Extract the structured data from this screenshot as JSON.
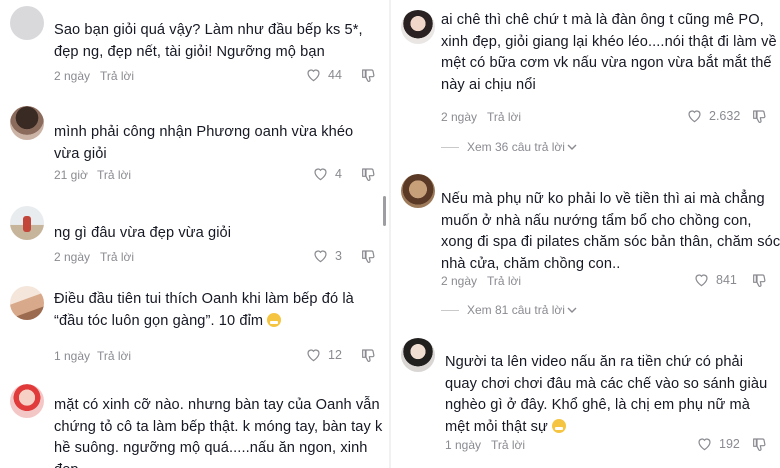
{
  "left": {
    "comments": [
      {
        "text": "Sao bạn giỏi quá vậy? Làm như đầu bếp ks 5*, đẹp ng, đẹp nết, tài giỏi! Ngưỡng mộ bạn",
        "time": "2 ngày",
        "reply": "Trả lời",
        "likes": "44"
      },
      {
        "text": "mình phải công nhận Phương oanh vừa khéo vừa giỏi",
        "time": "21 giờ",
        "reply": "Trả lời",
        "likes": "4"
      },
      {
        "text": "ng gì đâu vừa đẹp vừa giỏi",
        "time": "2 ngày",
        "reply": "Trả lời",
        "likes": "3"
      },
      {
        "text": "Điều đầu tiên tui thích Oanh khi làm bếp đó là “đầu tóc luôn gọn gàng”. 10 đỉm",
        "time": "1 ngày",
        "reply": "Trả lời",
        "likes": "12"
      },
      {
        "text": "mặt có xinh cỡ nào. nhưng bàn tay của Oanh vẫn chứng tỏ cô ta làm bếp thật. k móng tay, bàn tay k hề suông. ngưỡng mộ quá.....nấu ăn ngon, xinh đẹp"
      }
    ]
  },
  "right": {
    "comments": [
      {
        "text": "ai chê thì chê chứ t mà là đàn ông t cũng mê PO, xinh đẹp, giỏi giang lại khéo léo....nói thật đi làm về mệt có bữa cơm vk nấu vừa ngon vừa bắt mắt thế này ai chịu nổi",
        "time": "2 ngày",
        "reply": "Trả lời",
        "likes": "2.632",
        "more": "Xem 36 câu trả lời"
      },
      {
        "text": "Nếu mà phụ nữ ko phải lo về tiền thì ai mà chẳng muốn ở nhà nấu nướng tẩm bổ cho chồng con, xong đi spa đi pilates chăm sóc bản thân, chăm sóc nhà cửa, chăm chồng con..",
        "time": "2 ngày",
        "reply": "Trả lời",
        "likes": "841",
        "more": "Xem 81 câu trả lời"
      },
      {
        "text": "Người ta lên video nấu ăn ra tiền chứ có phải quay chơi chơi đâu mà các chế vào so sánh giàu nghèo gì ở đây. Khổ ghê, là chị em phụ nữ mà mệt mỏi thật sự",
        "time": "1 ngày",
        "reply": "Trả lời",
        "likes": "192"
      }
    ]
  },
  "icons": {
    "heart": "heart-outline-icon",
    "dislike": "thumbs-down-icon",
    "chevron": "chevron-down-icon",
    "emoji": "grinning-emoji-icon"
  }
}
